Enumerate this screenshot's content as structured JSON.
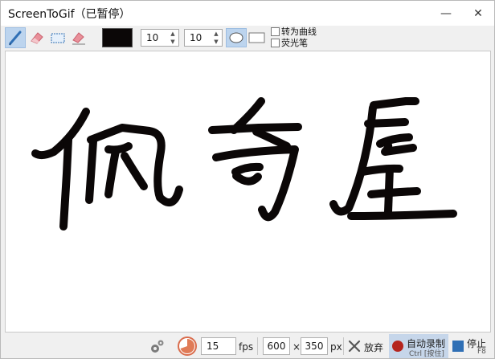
{
  "window": {
    "title": "ScreenToGif（已暂停）",
    "minimize_glyph": "—",
    "close_glyph": "✕"
  },
  "toolbar": {
    "tools": [
      {
        "name": "pen-tool",
        "icon": "pen-icon",
        "active": true
      },
      {
        "name": "eraser-tool",
        "icon": "eraser-icon",
        "active": false
      },
      {
        "name": "select-tool",
        "icon": "rectangle-select-icon",
        "active": false
      },
      {
        "name": "erase-stroke-tool",
        "icon": "stroke-eraser-icon",
        "active": false
      }
    ],
    "color": "#0b0707",
    "width_value": "10",
    "height_value": "10",
    "shapes": [
      {
        "name": "ellipse-tip",
        "icon": "ellipse-icon",
        "active": true
      },
      {
        "name": "rectangle-tip",
        "icon": "rectangle-icon",
        "active": false
      }
    ],
    "fit_to_curve_label": "转为曲线",
    "highlighter_label": "荧光笔"
  },
  "canvas": {
    "drawing": "handwritten-characters",
    "stroke_color": "#0b0707"
  },
  "statusbar": {
    "settings_icon": "gears-icon",
    "frame_rate_icon": "frame-rate-icon",
    "fps_value": "15",
    "fps_label": "fps",
    "width_value": "600",
    "times_label": "×",
    "height_value": "350",
    "px_label": "px",
    "discard_label": "放弃",
    "auto_record_label": "自动录制",
    "auto_record_shortcut": "Ctrl [按住]",
    "stop_label": "停止",
    "stop_shortcut": "F8"
  }
}
